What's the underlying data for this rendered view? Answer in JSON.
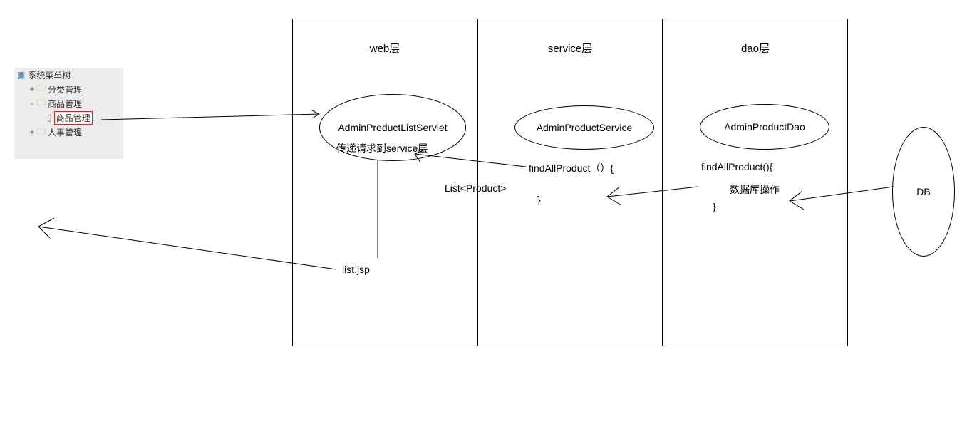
{
  "tree": {
    "root_label": "系统菜单树",
    "items": [
      {
        "label": "分类管理",
        "expander": "+"
      },
      {
        "label": "商品管理",
        "expander": "-",
        "children": [
          {
            "label": "商品管理",
            "selected": true
          }
        ]
      },
      {
        "label": "人事管理",
        "expander": "+"
      }
    ]
  },
  "layers": {
    "web": "web层",
    "service": "service层",
    "dao": "dao层"
  },
  "ellipses": {
    "servlet": "AdminProductListServlet",
    "service": "AdminProductService",
    "dao": "AdminProductDao",
    "db": "DB"
  },
  "text": {
    "servlet_note": "传递请求到service层",
    "service_find": "findAllProduct（）{",
    "list_return": "List<Product>",
    "service_close": "}",
    "dao_find": "findAllProduct(){",
    "db_op": "数据库操作",
    "dao_close": "}",
    "list_jsp": "list.jsp"
  }
}
